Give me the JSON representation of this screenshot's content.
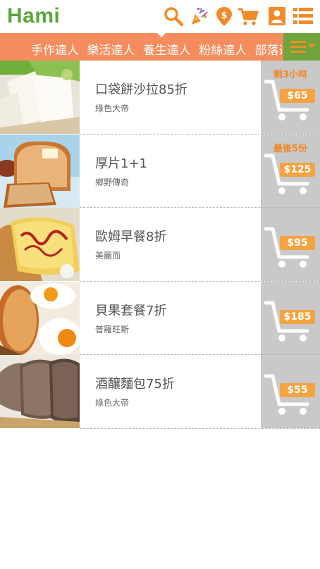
{
  "header": {
    "logo_text": "Hami",
    "icons": [
      "search-icon",
      "party-popper-icon",
      "dollar-pin-icon",
      "cart-icon",
      "user-icon",
      "list-menu-icon"
    ]
  },
  "categories": {
    "items": [
      "手作達人",
      "樂活達人",
      "養生達人",
      "粉絲達人",
      "部落達人"
    ]
  },
  "colors": {
    "brand_green": "#5aa63c",
    "header_orange": "#f58c5e",
    "menu_green": "#6ea43b",
    "badge_orange": "#f08a2a",
    "price_orange": "#f3a340",
    "buy_panel_gray": "#c9c9c9"
  },
  "deals": [
    {
      "title": "口袋餅沙拉85折",
      "seller": "綠色大帝",
      "price": "$65",
      "badge": "剩3小時"
    },
    {
      "title": "厚片1+1",
      "seller": "鄉野傳奇",
      "price": "$125",
      "badge": "最後5份"
    },
    {
      "title": "歐姆早餐8折",
      "seller": "美麗而",
      "price": "$95",
      "badge": ""
    },
    {
      "title": "貝果套餐7折",
      "seller": "普羅旺斯",
      "price": "$185",
      "badge": ""
    },
    {
      "title": "酒釀麵包75折",
      "seller": "綠色大帝",
      "price": "$55",
      "badge": ""
    }
  ]
}
